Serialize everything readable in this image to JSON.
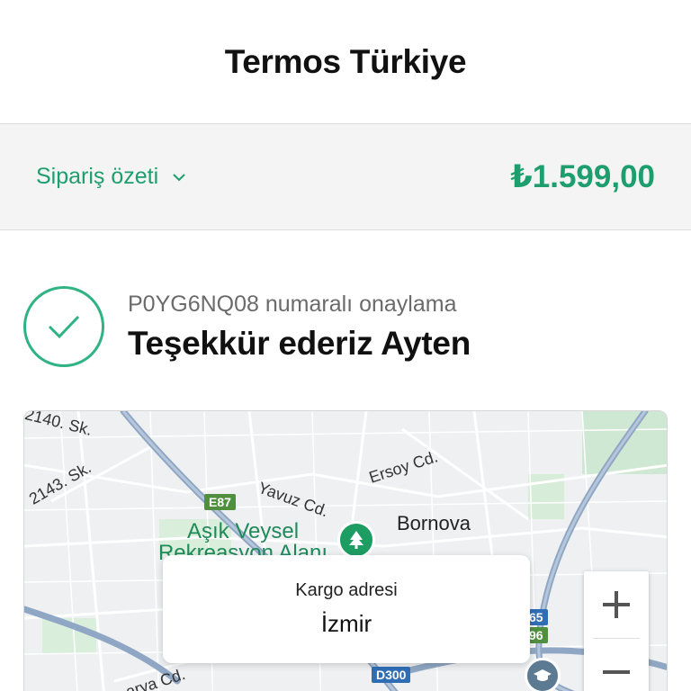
{
  "header": {
    "store_name": "Termos Türkiye"
  },
  "order_summary": {
    "toggle_label": "Sipariş özeti",
    "total": "₺1.599,00"
  },
  "confirmation": {
    "number_text": "P0YG6NQ08 numaralı onaylama",
    "thanks_text": "Teşekkür ederiz Ayten"
  },
  "map": {
    "streets": [
      "2140. Sk.",
      "2143. Sk.",
      "Ersoy Cd.",
      "Yavuz Cd.",
      "arya Cd."
    ],
    "district": "Bornova",
    "park": "Aşık Veysel Rekreasyon Alanı",
    "road_shields": [
      "E87",
      "65",
      "96",
      "D300"
    ],
    "shipping_card": {
      "label": "Kargo adresi",
      "city": "İzmir"
    },
    "zoom_in": "+",
    "zoom_out": "−"
  },
  "colors": {
    "accent": "#1d9e6e",
    "check": "#2fb383",
    "park": "#1e9d63"
  }
}
